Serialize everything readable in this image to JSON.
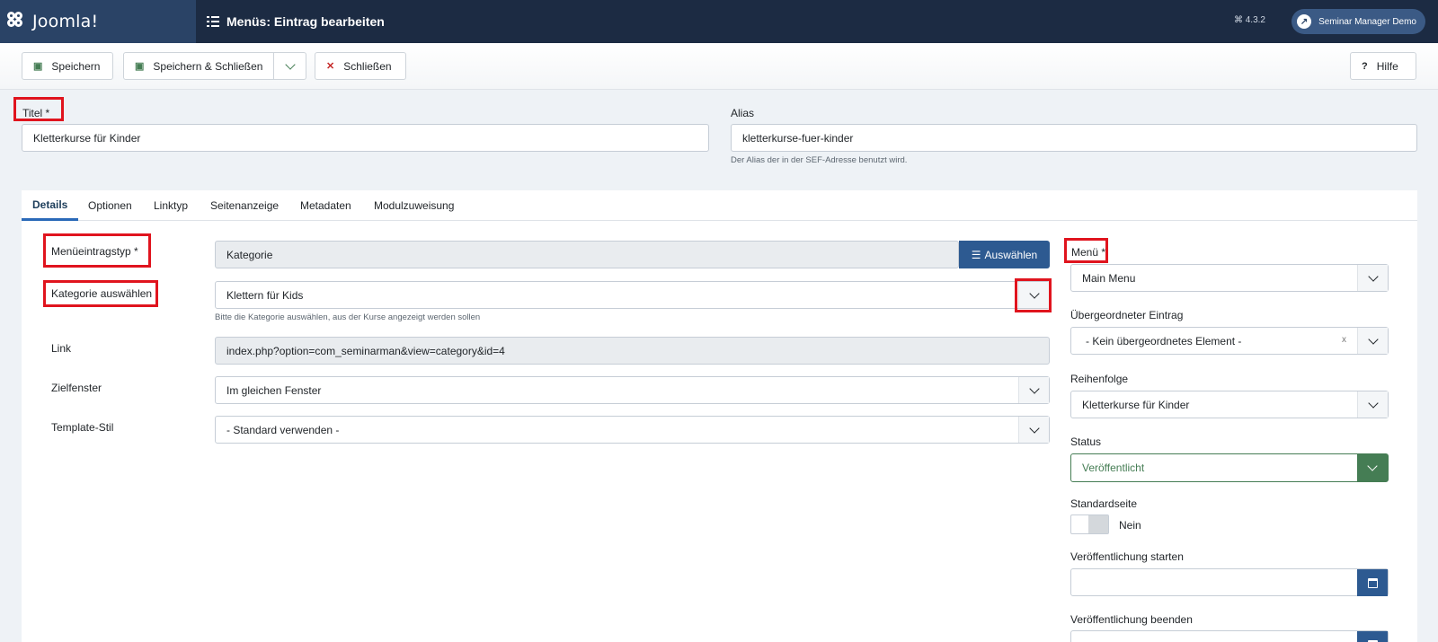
{
  "header": {
    "logo_text": "Joomla!",
    "page_title": "Menüs: Eintrag bearbeiten",
    "version": "4.3.2",
    "user_button": "Seminar Manager Demo"
  },
  "toolbar": {
    "save": "Speichern",
    "save_close": "Speichern & Schließen",
    "close": "Schließen",
    "help": "Hilfe"
  },
  "form": {
    "title_label": "Titel *",
    "title_value": "Kletterkurse für Kinder",
    "alias_label": "Alias",
    "alias_value": "kletterkurse-fuer-kinder",
    "alias_hint": "Der Alias der in der SEF-Adresse benutzt wird."
  },
  "tabs": [
    "Details",
    "Optionen",
    "Linktyp",
    "Seitenanzeige",
    "Metadaten",
    "Modulzuweisung"
  ],
  "details": {
    "menu_item_type_label": "Menüeintragstyp *",
    "menu_item_type_value": "Kategorie",
    "select_button": "Auswählen",
    "category_label": "Kategorie auswählen",
    "category_value": "Klettern für Kids",
    "category_hint": "Bitte die Kategorie auswählen, aus der Kurse angezeigt werden sollen",
    "link_label": "Link",
    "link_value": "index.php?option=com_seminarman&view=category&id=4",
    "target_label": "Zielfenster",
    "target_value": "Im gleichen Fenster",
    "template_label": "Template-Stil",
    "template_value": "- Standard verwenden -"
  },
  "sidebar": {
    "menu_label": "Menü *",
    "menu_value": "Main Menu",
    "parent_label": "Übergeordneter Eintrag",
    "parent_value": "- Kein übergeordnetes Element -",
    "clear_symbol": "x",
    "order_label": "Reihenfolge",
    "order_value": "Kletterkurse für Kinder",
    "status_label": "Status",
    "status_value": "Veröffentlicht",
    "home_label": "Standardseite",
    "home_value": "Nein",
    "publish_up_label": "Veröffentlichung starten",
    "publish_down_label": "Veröffentlichung beenden"
  },
  "colors": {
    "header_bg": "#1c2b43",
    "logo_bg": "#2a4366",
    "primary": "#2d5a91",
    "success": "#457d54",
    "danger": "#c52827",
    "highlight": "#e0141e"
  },
  "icons": {
    "menu": "list-icon",
    "save": "save-icon",
    "close": "x-icon",
    "help": "question-icon",
    "calendar": "calendar-icon"
  }
}
